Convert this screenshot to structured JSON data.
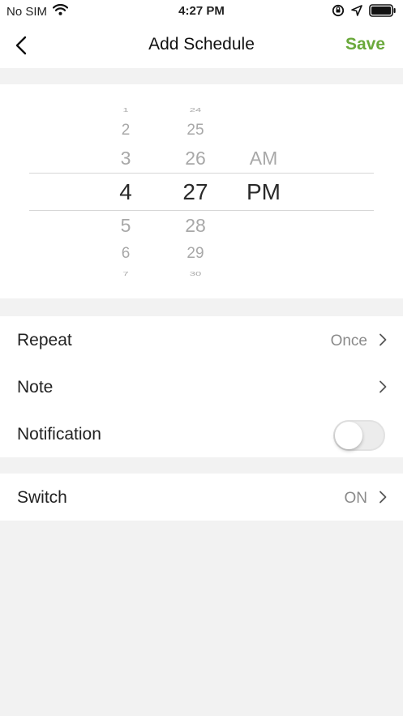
{
  "status_bar": {
    "carrier": "No SIM",
    "time": "4:27 PM"
  },
  "nav": {
    "title": "Add Schedule",
    "save_label": "Save",
    "accent_color": "#6aa93b"
  },
  "picker": {
    "hours": [
      "1",
      "2",
      "3",
      "4",
      "5",
      "6",
      "7"
    ],
    "selected_hour": "4",
    "minutes": [
      "24",
      "25",
      "26",
      "27",
      "28",
      "29",
      "30"
    ],
    "selected_minute": "27",
    "periods": [
      "AM",
      "PM"
    ],
    "selected_period": "PM"
  },
  "settings": {
    "repeat": {
      "label": "Repeat",
      "value": "Once"
    },
    "note": {
      "label": "Note",
      "value": ""
    },
    "notification": {
      "label": "Notification",
      "enabled": false
    }
  },
  "switch_row": {
    "label": "Switch",
    "value": "ON"
  }
}
